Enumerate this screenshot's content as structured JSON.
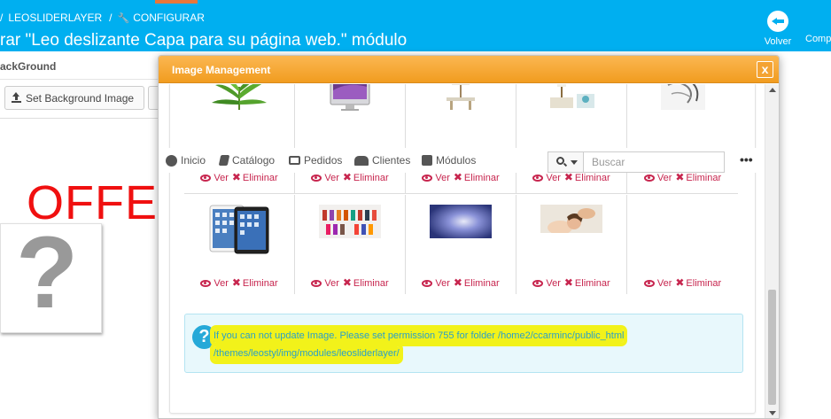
{
  "header": {
    "breadcrumb_sep1": "/",
    "breadcrumb_module": "LEOSLIDERLAYER",
    "breadcrumb_sep2": "/",
    "breadcrumb_configure": "CONFIGURAR",
    "page_title": "rar \"Leo deslizante Capa para su página web.\" módulo",
    "back_label": "Volver",
    "comp_label": "Comp",
    "bar_color": "#00aff0"
  },
  "background_panel": {
    "title": "ackGround",
    "set_background_button": "Set Background Image",
    "offer_text": "OFFER",
    "placeholder_glyph": "?"
  },
  "modal": {
    "title": "Image Management",
    "close_glyph": "x",
    "header_color": "#f5a538",
    "image_actions": {
      "view_label": "Ver",
      "delete_label": "Eliminar"
    },
    "images_row1": [
      {
        "icon": "plant-image"
      },
      {
        "icon": "imac-image"
      },
      {
        "icon": "lamp-image"
      },
      {
        "icon": "room-image"
      },
      {
        "icon": "sketch-image"
      }
    ],
    "images_row2": [
      {
        "icon": "ipad-image"
      },
      {
        "icon": "nail-polish-image"
      },
      {
        "icon": "blue-light-image"
      },
      {
        "icon": "spa-massage-image"
      },
      {
        "icon": "empty-slot"
      }
    ],
    "nav": {
      "items": [
        "Inicio",
        "Catálogo",
        "Pedidos",
        "Clientes",
        "Módulos"
      ],
      "search_placeholder": "Buscar",
      "more_glyph": "•••"
    },
    "alert": {
      "icon_glyph": "?",
      "line1": "If you can not update Image. Please set permission 755 for folder /home2/ccarminc/public_html",
      "line2": "/themes/leostyl/img/modules/leosliderlayer/",
      "highlight_color": "#f2f21a"
    }
  }
}
